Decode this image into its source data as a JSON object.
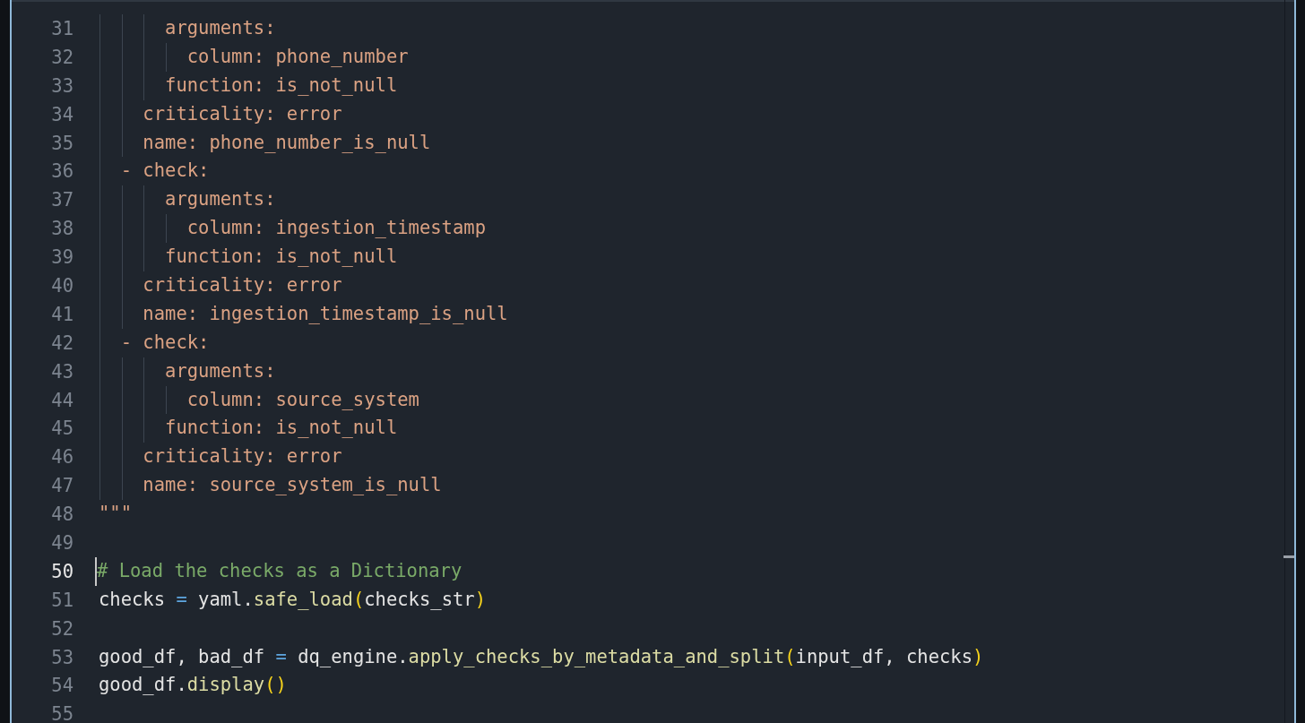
{
  "editor": {
    "lines": [
      {
        "number": "31",
        "current": false,
        "tokens": [
          {
            "kind": "string",
            "text": "      arguments:"
          }
        ]
      },
      {
        "number": "32",
        "current": false,
        "tokens": [
          {
            "kind": "string",
            "text": "        column: phone_number"
          }
        ]
      },
      {
        "number": "33",
        "current": false,
        "tokens": [
          {
            "kind": "string",
            "text": "      function: is_not_null"
          }
        ]
      },
      {
        "number": "34",
        "current": false,
        "tokens": [
          {
            "kind": "string",
            "text": "    criticality: error"
          }
        ]
      },
      {
        "number": "35",
        "current": false,
        "tokens": [
          {
            "kind": "string",
            "text": "    name: phone_number_is_null"
          }
        ]
      },
      {
        "number": "36",
        "current": false,
        "tokens": [
          {
            "kind": "string",
            "text": "  - check:"
          }
        ]
      },
      {
        "number": "37",
        "current": false,
        "tokens": [
          {
            "kind": "string",
            "text": "      arguments:"
          }
        ]
      },
      {
        "number": "38",
        "current": false,
        "tokens": [
          {
            "kind": "string",
            "text": "        column: ingestion_timestamp"
          }
        ]
      },
      {
        "number": "39",
        "current": false,
        "tokens": [
          {
            "kind": "string",
            "text": "      function: is_not_null"
          }
        ]
      },
      {
        "number": "40",
        "current": false,
        "tokens": [
          {
            "kind": "string",
            "text": "    criticality: error"
          }
        ]
      },
      {
        "number": "41",
        "current": false,
        "tokens": [
          {
            "kind": "string",
            "text": "    name: ingestion_timestamp_is_null"
          }
        ]
      },
      {
        "number": "42",
        "current": false,
        "tokens": [
          {
            "kind": "string",
            "text": "  - check:"
          }
        ]
      },
      {
        "number": "43",
        "current": false,
        "tokens": [
          {
            "kind": "string",
            "text": "      arguments:"
          }
        ]
      },
      {
        "number": "44",
        "current": false,
        "tokens": [
          {
            "kind": "string",
            "text": "        column: source_system"
          }
        ]
      },
      {
        "number": "45",
        "current": false,
        "tokens": [
          {
            "kind": "string",
            "text": "      function: is_not_null"
          }
        ]
      },
      {
        "number": "46",
        "current": false,
        "tokens": [
          {
            "kind": "string",
            "text": "    criticality: error"
          }
        ]
      },
      {
        "number": "47",
        "current": false,
        "tokens": [
          {
            "kind": "string",
            "text": "    name: source_system_is_null"
          }
        ]
      },
      {
        "number": "48",
        "current": false,
        "tokens": [
          {
            "kind": "string",
            "text": "\"\"\""
          }
        ]
      },
      {
        "number": "49",
        "current": false
      },
      {
        "number": "50",
        "current": true,
        "tokens": [
          {
            "kind": "comment",
            "text": "# Load the checks as a Dictionary"
          }
        ]
      },
      {
        "number": "51",
        "current": false,
        "tokens": [
          {
            "kind": "plain",
            "text": "checks "
          },
          {
            "kind": "operator",
            "text": "="
          },
          {
            "kind": "plain",
            "text": " yaml."
          },
          {
            "kind": "function",
            "text": "safe_load"
          },
          {
            "kind": "paren",
            "text": "("
          },
          {
            "kind": "plain",
            "text": "checks_str"
          },
          {
            "kind": "paren",
            "text": ")"
          }
        ]
      },
      {
        "number": "52",
        "current": false
      },
      {
        "number": "53",
        "current": false,
        "tokens": [
          {
            "kind": "plain",
            "text": "good_df, bad_df "
          },
          {
            "kind": "operator",
            "text": "="
          },
          {
            "kind": "plain",
            "text": " dq_engine."
          },
          {
            "kind": "function",
            "text": "apply_checks_by_metadata_and_split"
          },
          {
            "kind": "paren",
            "text": "("
          },
          {
            "kind": "plain",
            "text": "input_df, checks"
          },
          {
            "kind": "paren",
            "text": ")"
          }
        ]
      },
      {
        "number": "54",
        "current": false,
        "tokens": [
          {
            "kind": "plain",
            "text": "good_df."
          },
          {
            "kind": "function",
            "text": "display"
          },
          {
            "kind": "paren",
            "text": "()"
          }
        ]
      },
      {
        "number": "55",
        "current": false
      }
    ]
  }
}
